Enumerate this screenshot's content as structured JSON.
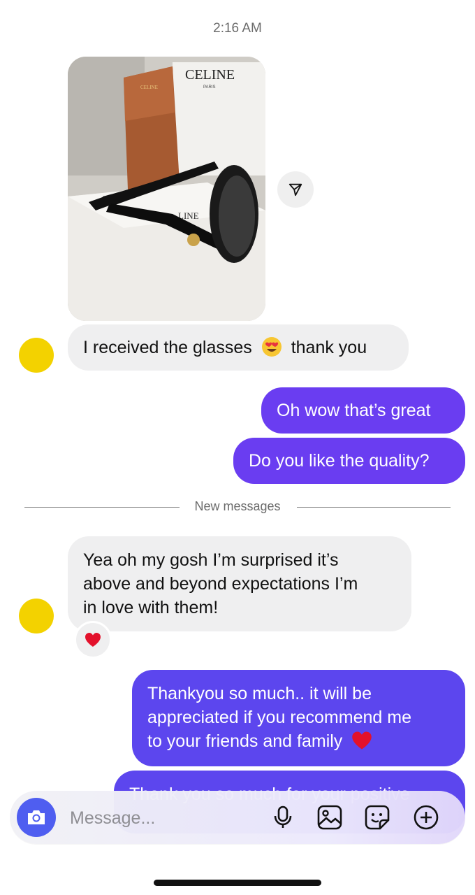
{
  "status": {
    "time": "2:16 AM"
  },
  "photo": {
    "box_brand": "CELINE",
    "box_sub": "PARIS",
    "case_brand": "CELINE",
    "box_side_text": "LINE"
  },
  "messages": [
    {
      "from": "them",
      "text_before": "I received the glasses",
      "emoji": "heart-eyes",
      "text_after": "thank you"
    },
    {
      "from": "me",
      "text": "Oh wow that’s great"
    },
    {
      "from": "me",
      "text": "Do you like the quality?"
    },
    {
      "from": "them",
      "lines": [
        "Yea oh my gosh I’m surprised it’s",
        "above and beyond expectations I’m",
        "in love with them!"
      ],
      "reaction": "red-heart"
    },
    {
      "from": "me",
      "lines": [
        "Thankyou so much.. it will be",
        "appreciated if you recommend me",
        "to your friends and family"
      ],
      "emoji": "red-heart"
    },
    {
      "from": "me",
      "partial": true,
      "text": "Thank you so much for your positive"
    }
  ],
  "divider": {
    "label": "New messages"
  },
  "composer": {
    "placeholder": "Message...",
    "icons": [
      "camera-icon",
      "microphone-icon",
      "gallery-icon",
      "sticker-icon",
      "add-icon"
    ],
    "accent": "#4f5ef0"
  },
  "colors": {
    "outgoing": "#6a3df1",
    "incoming": "#efeff0",
    "avatar": "#f3d200"
  }
}
